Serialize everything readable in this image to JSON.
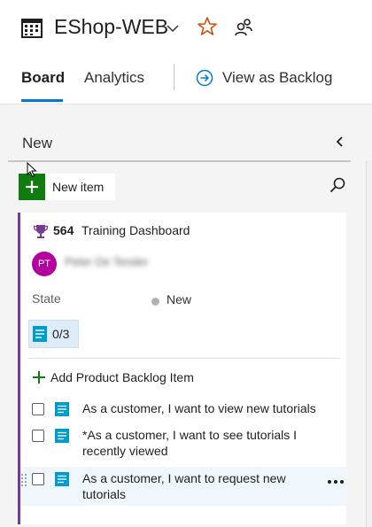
{
  "header": {
    "project_title": "EShop-WEB",
    "icons": [
      "board-grid-icon",
      "chevron-down-icon",
      "star-icon",
      "team-members-icon"
    ]
  },
  "tabs": [
    {
      "label": "Board",
      "selected": true
    },
    {
      "label": "Analytics",
      "selected": false
    },
    {
      "label": "View as Backlog",
      "selected": false
    }
  ],
  "column": {
    "title": "New",
    "new_item_label": "New item",
    "card": {
      "id": "564",
      "title": "Training Dashboard",
      "avatar_initials": "PT",
      "assignee": "Peter De Tender",
      "state_label": "State",
      "state_value": "New",
      "task_count": "0/3",
      "add_child_label": "Add Product Backlog Item",
      "accent_color": "#773b93",
      "children": [
        {
          "text": "As a customer, I want to view new tutorials"
        },
        {
          "text": "*As a customer, I want to see tutorials I recently viewed"
        },
        {
          "text": "As a customer, I want to request new tutorials"
        }
      ]
    }
  },
  "colors": {
    "accent": "#0078d4",
    "add_green": "#107c10",
    "avatar": "#b4009e",
    "star": "#ca5010"
  }
}
